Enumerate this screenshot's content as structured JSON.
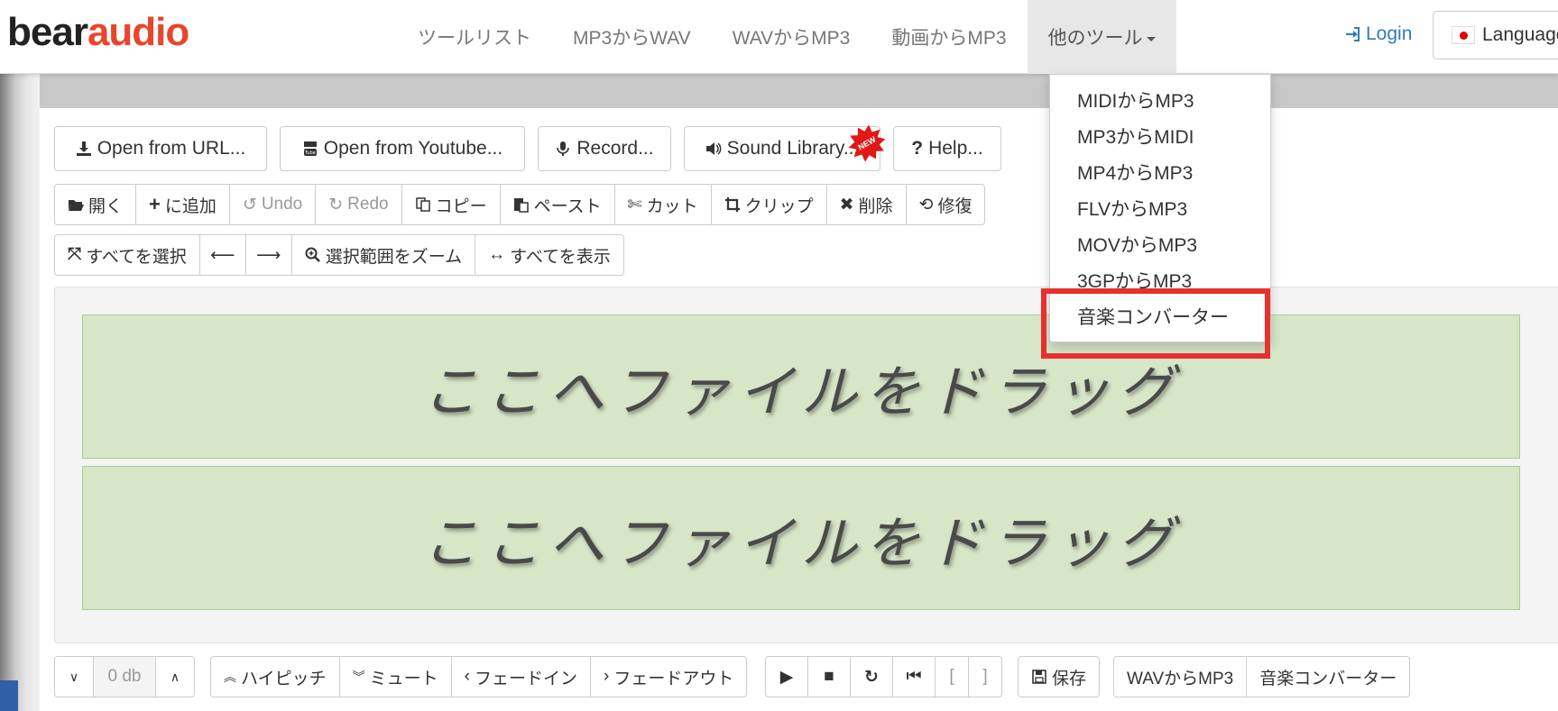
{
  "logo": {
    "part1": "bear",
    "part2": "audio"
  },
  "nav": {
    "items": [
      "ツールリスト",
      "MP3からWAV",
      "WAVからMP3",
      "動画からMP3"
    ],
    "more": "他のツール",
    "login": "Login",
    "language": "Language"
  },
  "dropdown": {
    "items": [
      "MIDIからMP3",
      "MP3からMIDI",
      "MP4からMP3",
      "FLVからMP3",
      "MOVからMP3",
      "3GPからMP3",
      "音楽コンバーター"
    ]
  },
  "toolbar1": {
    "open_url": "Open from URL...",
    "open_youtube": "Open from Youtube...",
    "record": "Record...",
    "sound_library": "Sound Library...",
    "new_badge": "NEW",
    "help": "Help..."
  },
  "toolbar2": {
    "open": "開く",
    "add": "に追加",
    "undo": "Undo",
    "redo": "Redo",
    "copy": "コピー",
    "paste": "ペースト",
    "cut": "カット",
    "clip": "クリップ",
    "delete": "削除",
    "repair": "修復"
  },
  "toolbar3": {
    "select_all": "すべてを選択",
    "zoom_selection": "選択範囲をズーム",
    "show_all": "すべてを表示"
  },
  "drop_zone": {
    "text": "ここへファイルをドラッグ"
  },
  "bottom": {
    "volume": "0 db",
    "high_pitch": "ハイピッチ",
    "mute": "ミュート",
    "fade_in": "フェードイン",
    "fade_out": "フェードアウト",
    "bracket_open": "[",
    "bracket_close": "]",
    "save": "保存",
    "wav_to_mp3": "WAVからMP3",
    "music_converter": "音楽コンバーター"
  },
  "colors": {
    "accent": "#e8452c",
    "link": "#337ab7",
    "drop_zone": "#d6e6c7",
    "highlight": "#e8302f"
  }
}
